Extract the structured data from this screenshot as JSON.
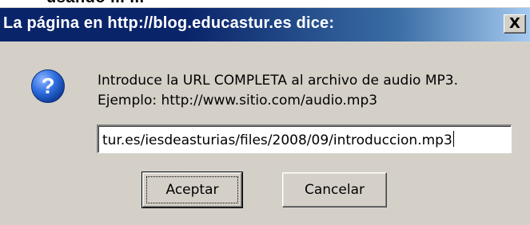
{
  "background": {
    "partial_text": "usando ... ..."
  },
  "dialog": {
    "title": "La página en http://blog.educastur.es dice:",
    "close_label": "X",
    "icon": "question-icon",
    "message_line1": "Introduce la URL COMPLETA al archivo de audio MP3.",
    "message_line2": "Ejemplo: http://www.sitio.com/audio.mp3",
    "input_value": "tur.es/iesdeasturias/files/2008/09/introduccion.mp3",
    "ok_label": "Aceptar",
    "cancel_label": "Cancelar"
  },
  "colors": {
    "titlebar_start": "#0a246a",
    "titlebar_end": "#a6caf0",
    "dialog_bg": "#d4d0c8",
    "icon_blue": "#1f5bc4"
  }
}
